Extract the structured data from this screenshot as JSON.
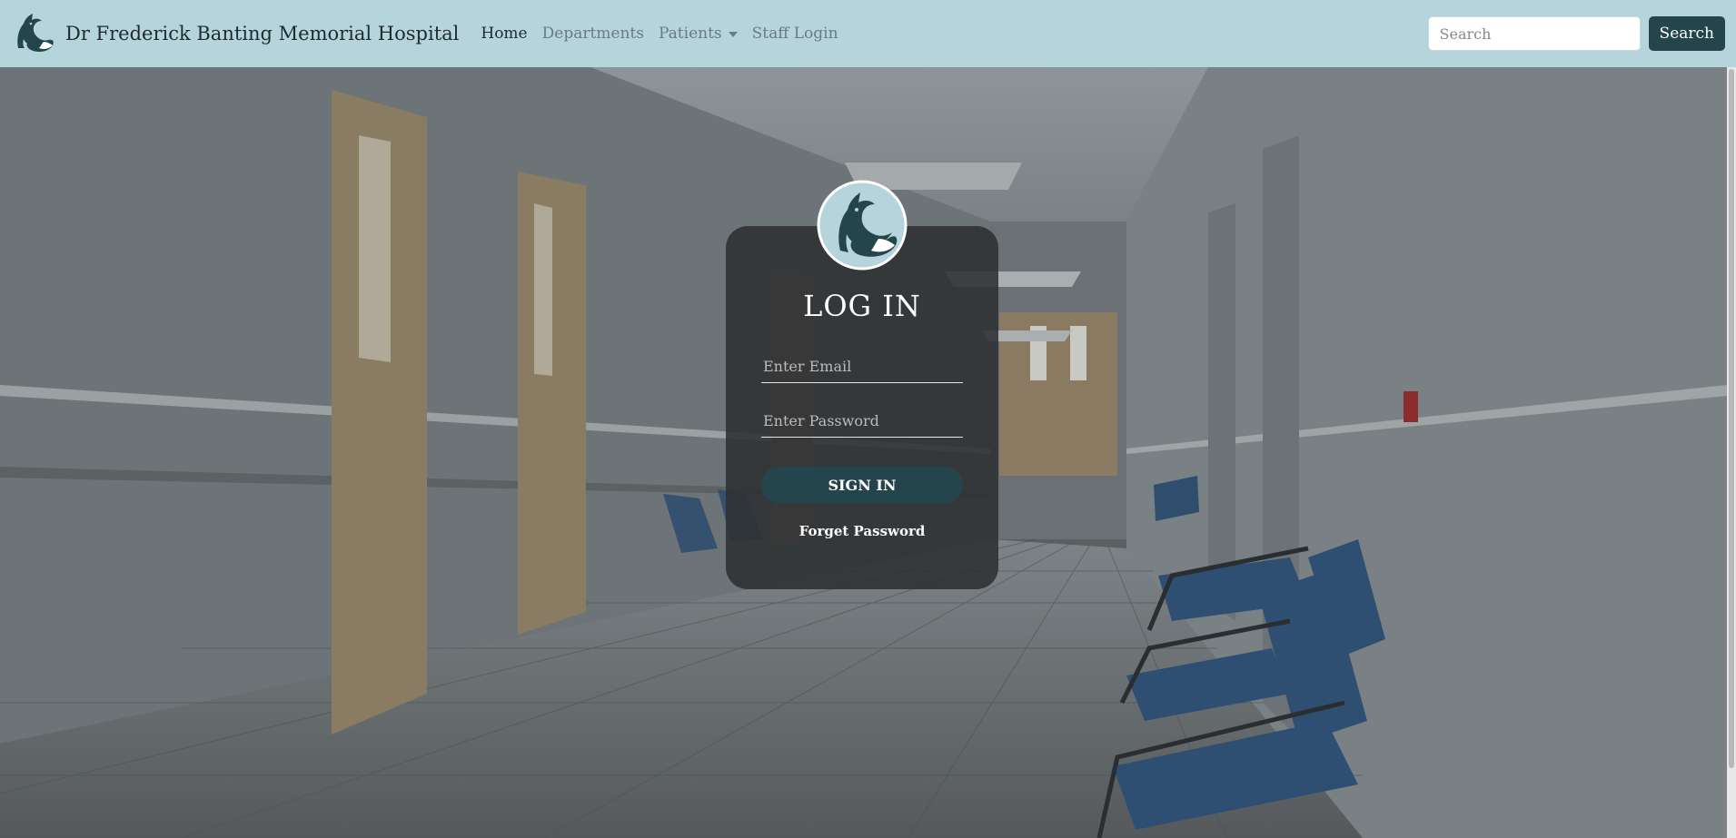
{
  "navbar": {
    "brand": "Dr Frederick Banting Memorial Hospital",
    "links": {
      "home": "Home",
      "departments": "Departments",
      "patients": "Patients",
      "staff_login": "Staff Login"
    },
    "search": {
      "placeholder": "Search",
      "value": "",
      "button_label": "Search"
    }
  },
  "login": {
    "title": "LOG IN",
    "email_placeholder": "Enter Email",
    "password_placeholder": "Enter Password",
    "signin_label": "SIGN IN",
    "forgot_label": "Forget Password"
  },
  "colors": {
    "navbar_bg": "#b5d4dc",
    "accent": "#23454b",
    "logo_bg": "#b5d4dc",
    "card_bg": "#2d3032"
  },
  "icons": {
    "brand_logo": "fox-logo-icon",
    "card_logo": "fox-logo-icon",
    "patients_dropdown": "caret-down-icon"
  }
}
